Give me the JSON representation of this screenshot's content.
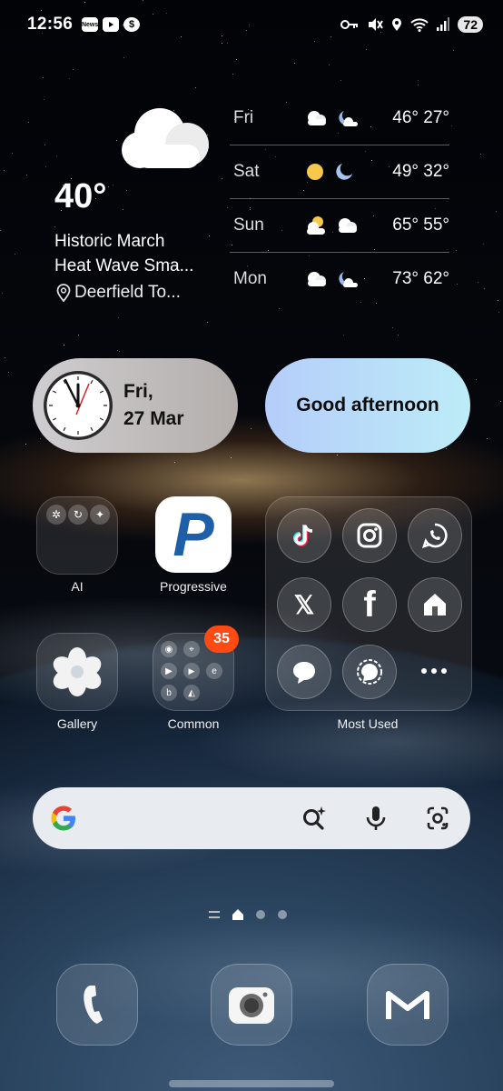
{
  "status_bar": {
    "time": "12:56",
    "notif_news": "News",
    "notif_dollar": "$",
    "battery": "72"
  },
  "weather": {
    "current_temp": "40°",
    "headline_line1": "Historic March",
    "headline_line2": "Heat Wave Sma...",
    "location": "Deerfield To...",
    "forecast": [
      {
        "day": "Fri",
        "temps": "46° 27°",
        "icons": [
          "cloud",
          "moon-cloud"
        ]
      },
      {
        "day": "Sat",
        "temps": "49° 32°",
        "icons": [
          "sun",
          "moon"
        ]
      },
      {
        "day": "Sun",
        "temps": "65° 55°",
        "icons": [
          "sun-cloud",
          "cloud"
        ]
      },
      {
        "day": "Mon",
        "temps": "73° 62°",
        "icons": [
          "cloud",
          "moon-cloud"
        ]
      }
    ]
  },
  "clock_widget": {
    "date_line1": "Fri,",
    "date_line2": "27 Mar",
    "clock_number": "12"
  },
  "greeting": "Good afternoon",
  "apps": {
    "ai_label": "AI",
    "progressive_label": "Progressive",
    "progressive_letter": "P",
    "gallery_label": "Gallery",
    "common_label": "Common",
    "common_badge": "35",
    "most_used_label": "Most Used",
    "x_letter": "𝕏",
    "facebook_letter": "f"
  },
  "colors": {
    "badge": "#ff4a14",
    "progressive_blue": "#1f5fa8",
    "greeting_gradient": [
      "#b5cdfa",
      "#bdecf7"
    ]
  }
}
